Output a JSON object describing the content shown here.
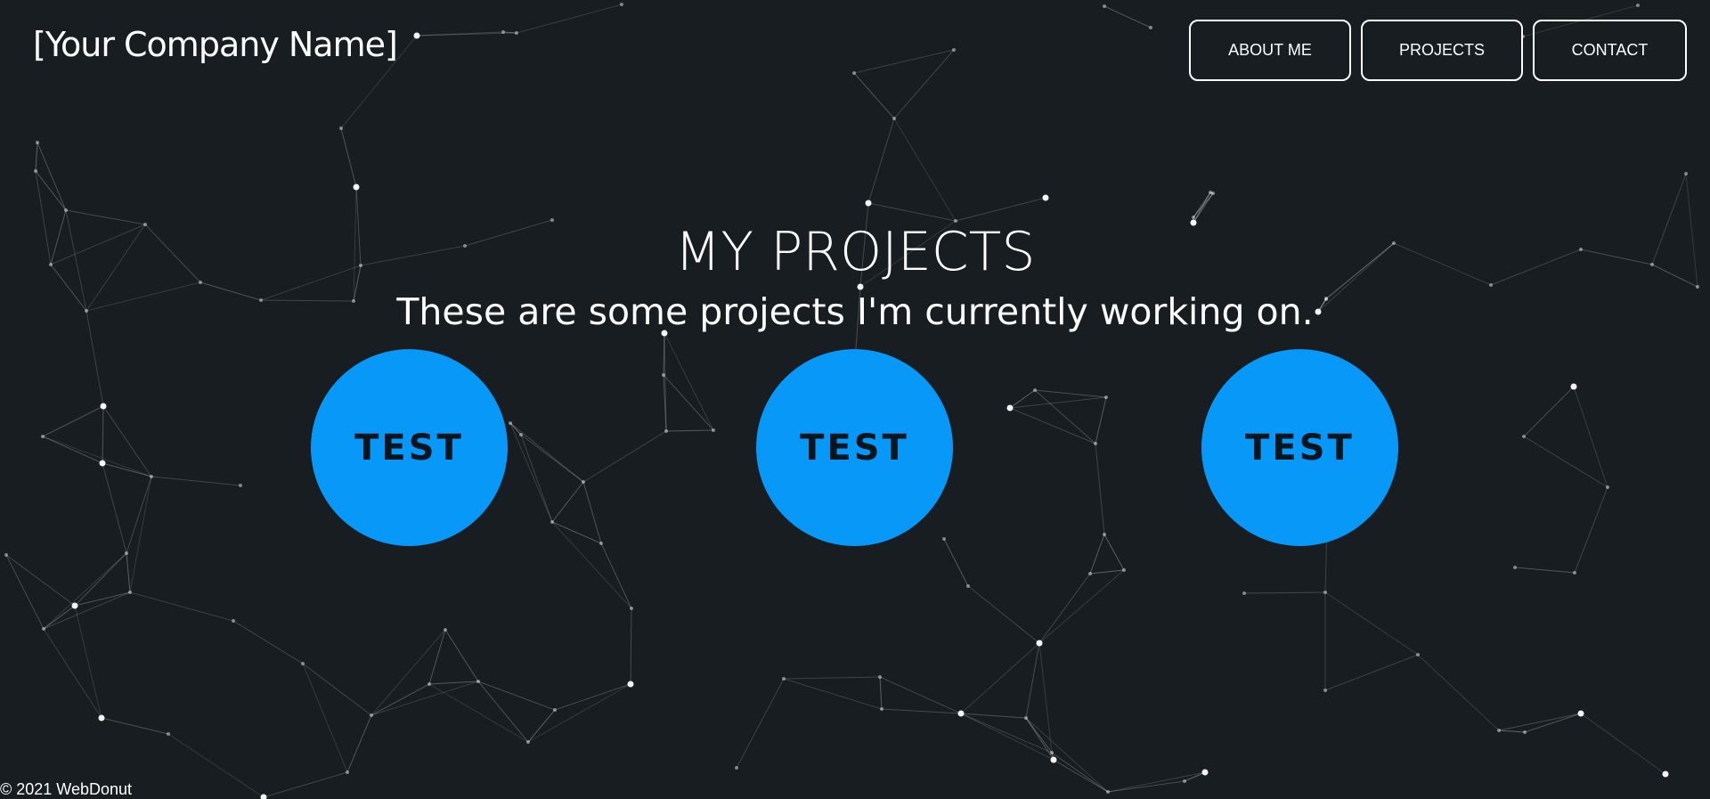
{
  "brand": {
    "name": "[Your Company Name]"
  },
  "nav": {
    "about": "ABOUT ME",
    "projects": "PROJECTS",
    "contact": "CONTACT"
  },
  "main": {
    "title": "MY PROJECTS",
    "subtitle": "These are some projects I'm currently working on.",
    "projects": [
      {
        "label": "TEST",
        "color": "#0798f8"
      },
      {
        "label": "TEST",
        "color": "#0798f8"
      },
      {
        "label": "TEST",
        "color": "#0798f8"
      }
    ]
  },
  "footer": {
    "text": "© 2021 WebDonut"
  },
  "colors": {
    "background": "#171d20",
    "accent": "#0798f8",
    "text": "#ffffff"
  }
}
